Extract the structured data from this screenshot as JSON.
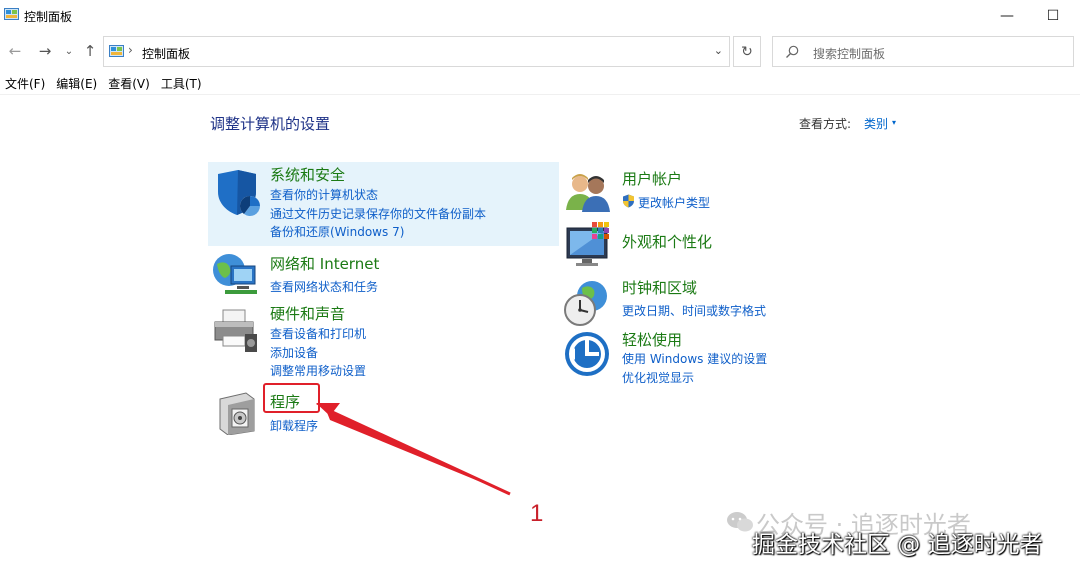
{
  "window": {
    "title": "控制面板",
    "minimize_glyph": "—",
    "maximize_glyph": "☐"
  },
  "nav": {
    "back": "←",
    "forward": "→",
    "recent": "⌄",
    "up": "↑",
    "address_separator": "›",
    "address": "控制面板",
    "address_dropdown": "⌄",
    "refresh": "↻",
    "search_placeholder": "搜索控制面板"
  },
  "menu": [
    "文件(F)",
    "编辑(E)",
    "查看(V)",
    "工具(T)"
  ],
  "main": {
    "heading": "调整计算机的设置",
    "view_by_label": "查看方式:",
    "view_by_value": "类别",
    "view_by_caret": "▾"
  },
  "categories": {
    "security": {
      "title": "系统和安全",
      "links": [
        "查看你的计算机状态",
        "通过文件历史记录保存你的文件备份副本",
        "备份和还原(Windows 7)"
      ],
      "icon": "shield-icon"
    },
    "network": {
      "title": "网络和 Internet",
      "links": [
        "查看网络状态和任务"
      ],
      "icon": "network-globe-icon"
    },
    "hardware": {
      "title": "硬件和声音",
      "links": [
        "查看设备和打印机",
        "添加设备",
        "调整常用移动设置"
      ],
      "icon": "printer-icon"
    },
    "programs": {
      "title": "程序",
      "links": [
        "卸载程序"
      ],
      "icon": "programs-box-icon"
    },
    "users": {
      "title": "用户帐户",
      "links": [
        "更改帐户类型"
      ],
      "icon": "users-icon"
    },
    "appearance": {
      "title": "外观和个性化",
      "links": [],
      "icon": "monitor-palette-icon"
    },
    "clock": {
      "title": "时钟和区域",
      "links": [
        "更改日期、时间或数字格式"
      ],
      "icon": "clock-globe-icon"
    },
    "ease": {
      "title": "轻松使用",
      "links": [
        "使用 Windows 建议的设置",
        "优化视觉显示"
      ],
      "icon": "ease-of-access-icon"
    }
  },
  "annotation": {
    "number": "1",
    "color": "#e0202a"
  },
  "watermark": {
    "account": "公众号 · 追逐时光者",
    "community": "掘金技术社区 @ 追逐时光者"
  },
  "colors": {
    "category_title": "#1b7a14",
    "link": "#0f5fc9",
    "heading": "#1e3287",
    "highlight": "#e5f3fb"
  }
}
